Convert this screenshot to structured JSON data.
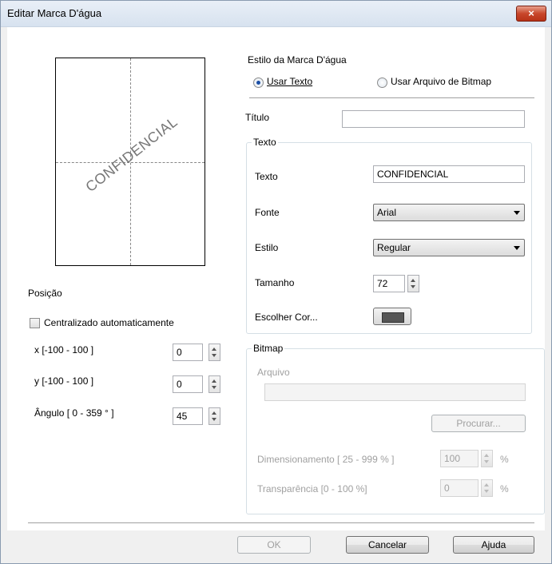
{
  "window": {
    "title": "Editar Marca D'água",
    "close_icon": "×"
  },
  "preview": {
    "watermark_text": "CONFIDENCIAL"
  },
  "position": {
    "heading": "Posição",
    "auto_center_label": "Centralizado automaticamente",
    "auto_center_checked": false,
    "x_label": "x [-100  -  100 ]",
    "x_value": "0",
    "y_label": "y [-100  -  100 ]",
    "y_value": "0",
    "angle_label": "Ângulo [ 0 - 359 ° ]",
    "angle_value": "45"
  },
  "style": {
    "heading": "Estilo da Marca D'água",
    "use_text_label": "Usar Texto",
    "use_bitmap_label": "Usar Arquivo de Bitmap",
    "selected": "text"
  },
  "title_field": {
    "label": "Título",
    "value": ""
  },
  "text_group": {
    "title": "Texto",
    "text_label": "Texto",
    "text_value": "CONFIDENCIAL",
    "font_label": "Fonte",
    "font_value": "Arial",
    "style_label": "Estilo",
    "style_value": "Regular",
    "size_label": "Tamanho",
    "size_value": "72",
    "color_label": "Escolher Cor...",
    "color": "#555555"
  },
  "bitmap_group": {
    "title": "Bitmap",
    "file_label": "Arquivo",
    "file_value": "",
    "browse_label": "Procurar...",
    "scale_label": "Dimensionamento [ 25 - 999 % ]",
    "scale_value": "100",
    "scale_unit": "%",
    "transparency_label": "Transparência [0 - 100 %]",
    "transparency_value": "0",
    "transparency_unit": "%"
  },
  "buttons": {
    "ok": "OK",
    "cancel": "Cancelar",
    "help": "Ajuda"
  }
}
